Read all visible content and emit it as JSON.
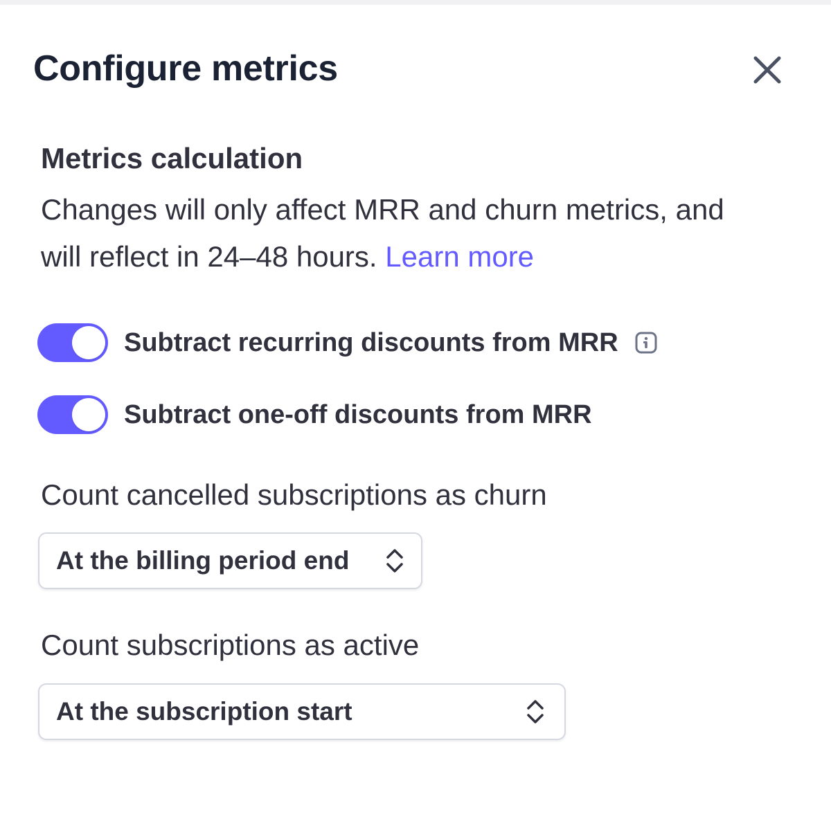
{
  "panel": {
    "title": "Configure metrics",
    "close_icon": "close-icon"
  },
  "section": {
    "heading": "Metrics calculation",
    "description": "Changes will only affect MRR and churn metrics, and will reflect in 24–48 hours.",
    "learn_more": "Learn more"
  },
  "toggles": [
    {
      "label": "Subtract recurring discounts from MRR",
      "checked": true,
      "has_info_icon": true,
      "info_icon": "info-icon"
    },
    {
      "label": "Subtract one-off discounts from MRR",
      "checked": true,
      "has_info_icon": false
    }
  ],
  "churn_setting": {
    "label": "Count cancelled subscriptions as churn",
    "value": "At the billing period end",
    "icon": "chevron-up-down-icon"
  },
  "active_setting": {
    "label": "Count subscriptions as active",
    "value": "At the subscription start",
    "icon": "chevron-up-down-icon"
  },
  "colors": {
    "accent": "#635bff",
    "text_primary": "#30313d",
    "title": "#1a2233",
    "border": "#d5d8e1"
  }
}
